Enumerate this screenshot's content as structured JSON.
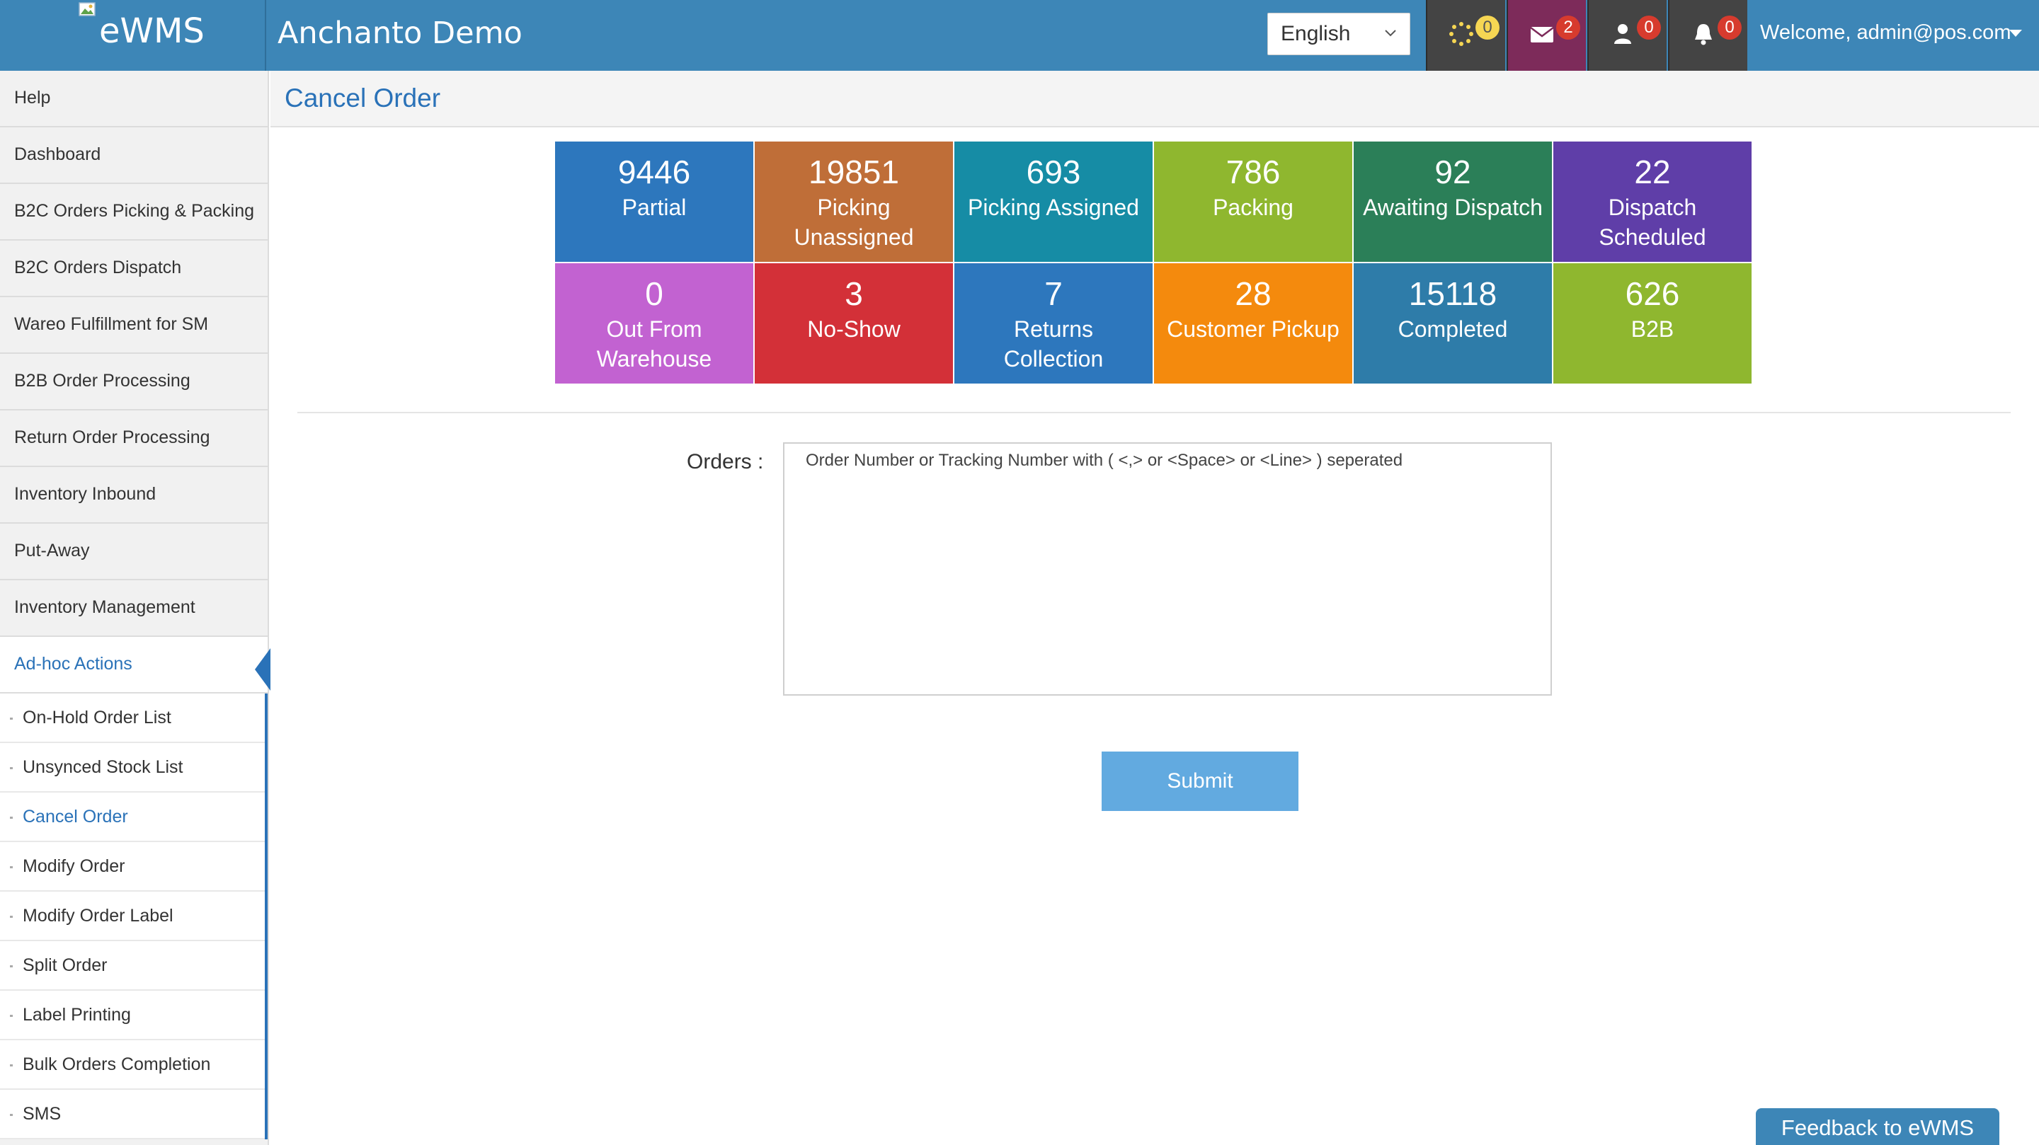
{
  "header": {
    "brand": "eWMS",
    "title": "Anchanto Demo",
    "language": "English",
    "badges": {
      "sync": "0",
      "messages": "2",
      "users": "0",
      "alerts": "0"
    },
    "welcome": "Welcome, admin@pos.com"
  },
  "sidebar": {
    "items": [
      {
        "label": "Help"
      },
      {
        "label": "Dashboard"
      },
      {
        "label": "B2C Orders Picking & Packing"
      },
      {
        "label": "B2C Orders Dispatch"
      },
      {
        "label": "Wareo Fulfillment for SM"
      },
      {
        "label": "B2B Order Processing"
      },
      {
        "label": "Return Order Processing"
      },
      {
        "label": "Inventory Inbound"
      },
      {
        "label": "Put-Away"
      },
      {
        "label": "Inventory Management"
      },
      {
        "label": "Ad-hoc Actions"
      }
    ],
    "subitems": [
      {
        "label": "On-Hold Order List"
      },
      {
        "label": "Unsynced Stock List"
      },
      {
        "label": "Cancel Order"
      },
      {
        "label": "Modify Order"
      },
      {
        "label": "Modify Order Label"
      },
      {
        "label": "Split Order"
      },
      {
        "label": "Label Printing"
      },
      {
        "label": "Bulk Orders Completion"
      },
      {
        "label": "SMS"
      }
    ]
  },
  "page": {
    "title": "Cancel Order"
  },
  "tiles": [
    {
      "count": "9446",
      "label": "Partial",
      "color": "#2d77bd"
    },
    {
      "count": "19851",
      "label": "Picking Unassigned",
      "color": "#bf6e38"
    },
    {
      "count": "693",
      "label": "Picking Assigned",
      "color": "#168ca5"
    },
    {
      "count": "786",
      "label": "Packing",
      "color": "#8fb72f"
    },
    {
      "count": "92",
      "label": "Awaiting Dispatch",
      "color": "#2b7f58"
    },
    {
      "count": "22",
      "label": "Dispatch Scheduled",
      "color": "#5f3ea8"
    },
    {
      "count": "0",
      "label": "Out From Warehouse",
      "color": "#c262d1"
    },
    {
      "count": "3",
      "label": "No-Show",
      "color": "#d33038"
    },
    {
      "count": "7",
      "label": "Returns Collection",
      "color": "#2d77bd"
    },
    {
      "count": "28",
      "label": "Customer Pickup",
      "color": "#f48a0d"
    },
    {
      "count": "15118",
      "label": "Completed",
      "color": "#2e7ca9"
    },
    {
      "count": "626",
      "label": "B2B",
      "color": "#8fb72f"
    }
  ],
  "form": {
    "orders_label": "Orders :",
    "orders_placeholder": "Order Number or Tracking Number with ( <,> or <Space> or <Line> ) seperated",
    "orders_value": "",
    "submit_label": "Submit"
  },
  "feedback": {
    "label": "Feedback to eWMS"
  }
}
